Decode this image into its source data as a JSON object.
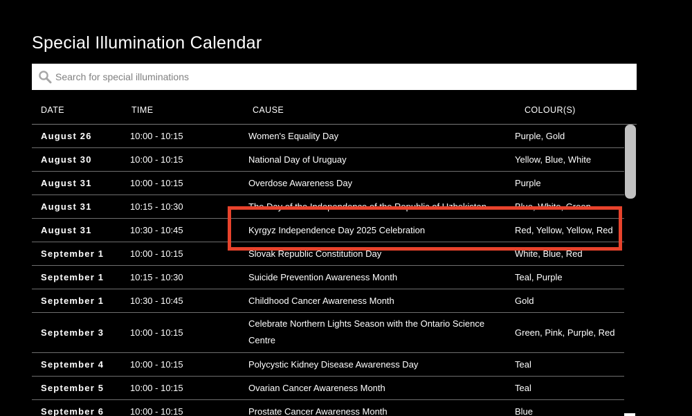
{
  "page": {
    "title": "Special Illumination Calendar"
  },
  "search": {
    "placeholder": "Search for special illuminations",
    "value": ""
  },
  "table": {
    "headers": {
      "date": "DATE",
      "time": "TIME",
      "cause": "CAUSE",
      "colours": "COLOUR(S)"
    },
    "rows": [
      {
        "date": "August 26",
        "time": "10:00 - 10:15",
        "cause": "Women's Equality Day",
        "colours": "Purple, Gold"
      },
      {
        "date": "August 30",
        "time": "10:00 - 10:15",
        "cause": "National Day of Uruguay",
        "colours": "Yellow, Blue, White"
      },
      {
        "date": "August 31",
        "time": "10:00 - 10:15",
        "cause": "Overdose Awareness Day",
        "colours": "Purple"
      },
      {
        "date": "August 31",
        "time": "10:15 - 10:30",
        "cause": "The Day of the Independence of the Republic of Uzbekistan",
        "colours": "Blue, White, Green"
      },
      {
        "date": "August 31",
        "time": "10:30 - 10:45",
        "cause": "Kyrgyz Independence Day 2025 Celebration",
        "colours": "Red, Yellow, Yellow, Red"
      },
      {
        "date": "September 1",
        "time": "10:00 - 10:15",
        "cause": "Slovak Republic Constitution Day",
        "colours": "White, Blue, Red"
      },
      {
        "date": "September 1",
        "time": "10:15 - 10:30",
        "cause": "Suicide Prevention Awareness Month",
        "colours": "Teal, Purple"
      },
      {
        "date": "September 1",
        "time": "10:30 - 10:45",
        "cause": "Childhood Cancer Awareness Month",
        "colours": "Gold"
      },
      {
        "date": "September 3",
        "time": "10:00 - 10:15",
        "cause": "Celebrate Northern Lights Season with the Ontario Science Centre",
        "colours": "Green, Pink, Purple, Red"
      },
      {
        "date": "September 4",
        "time": "10:00 - 10:15",
        "cause": "Polycystic Kidney Disease Awareness Day",
        "colours": "Teal"
      },
      {
        "date": "September 5",
        "time": "10:00 - 10:15",
        "cause": "Ovarian Cancer Awareness Month",
        "colours": "Teal"
      },
      {
        "date": "September 6",
        "time": "10:00 - 10:15",
        "cause": "Prostate Cancer Awareness Month",
        "colours": "Blue"
      }
    ]
  },
  "icons": {
    "search": "search-icon"
  },
  "colors": {
    "background": "#000000",
    "text": "#ffffff",
    "highlight": "#e8432c",
    "scroll_thumb": "#c1c1c1"
  }
}
